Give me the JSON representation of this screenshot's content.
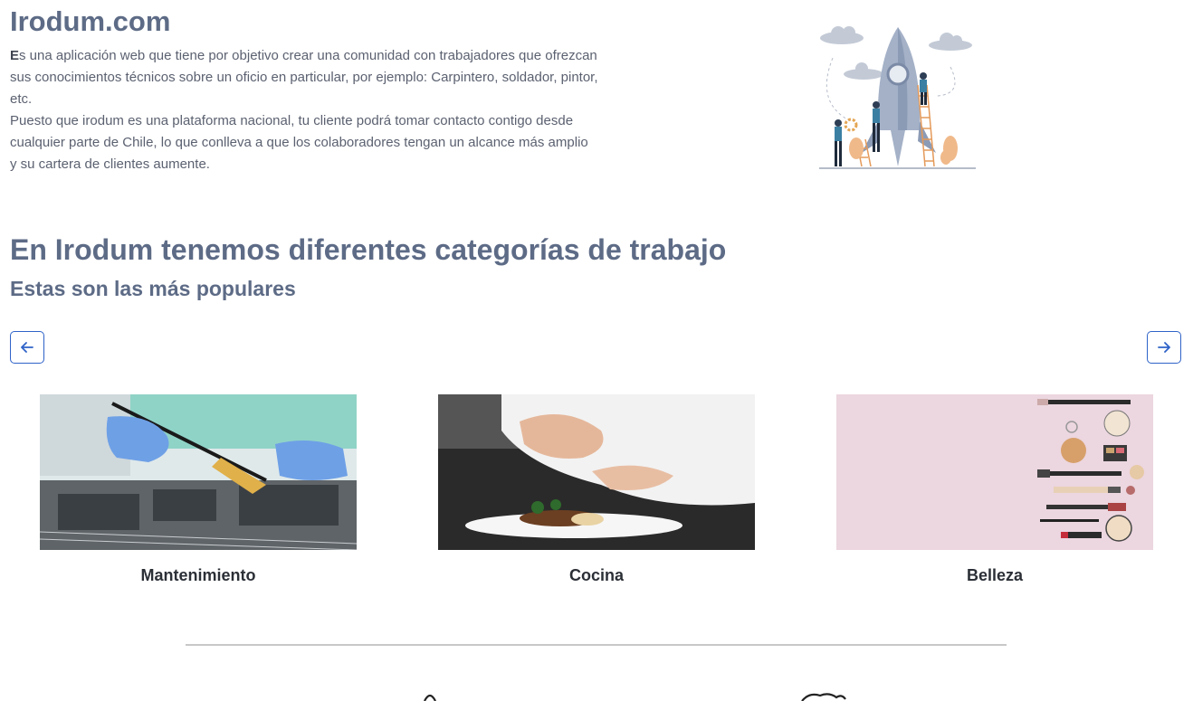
{
  "header": {
    "title": "Irodum.com"
  },
  "intro": {
    "first_letter": "E",
    "line1": "s una aplicación web que tiene por objetivo crear una comunidad con trabajadores que ofrezcan sus conocimientos técnicos sobre un oficio en particular, por ejemplo: Carpintero, soldador, pintor, etc.",
    "line2": "Puesto que irodum es una plataforma nacional, tu cliente podrá tomar contacto contigo desde cualquier parte de Chile, lo que conlleva a que los colaboradores tengan un alcance más amplio y su cartera de clientes aumente."
  },
  "categories": {
    "title": "En Irodum tenemos diferentes categorías de trabajo",
    "subtitle": "Estas son las más populares",
    "items": [
      {
        "label": "Mantenimiento",
        "image": "laptop-repair-photo"
      },
      {
        "label": "Cocina",
        "image": "chef-plating-photo"
      },
      {
        "label": "Belleza",
        "image": "makeup-products-photo"
      }
    ]
  },
  "icons": {
    "prev": "arrow-left-icon",
    "next": "arrow-right-icon"
  },
  "colors": {
    "heading": "#5d6b86",
    "accent": "#2f63c8"
  }
}
